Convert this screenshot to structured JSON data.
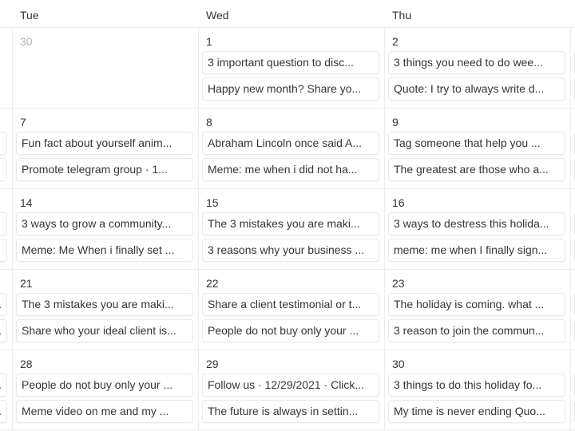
{
  "header": {
    "days": [
      "Tue",
      "Wed",
      "Thu"
    ]
  },
  "weeks": [
    {
      "days": [
        {
          "date": "30",
          "muted": true,
          "cards": []
        },
        {
          "date": "1",
          "cards": [
            "3 important question to disc...",
            "Happy new month? Share yo..."
          ]
        },
        {
          "date": "2",
          "cards": [
            "3 things you need to do wee...",
            "Quote: I try to always write d..."
          ]
        }
      ]
    },
    {
      "days": [
        {
          "date": "7",
          "cards": [
            "Fun fact about yourself anim...",
            "Promote telegram group  · 1..."
          ]
        },
        {
          "date": "8",
          "cards": [
            "Abraham Lincoln once said A...",
            "Meme: me when i did not ha..."
          ]
        },
        {
          "date": "9",
          "cards": [
            "Tag someone that help you ...",
            "The greatest are those who a..."
          ]
        }
      ]
    },
    {
      "days": [
        {
          "date": "14",
          "cards": [
            "3 ways to grow a community...",
            "Meme: Me When i finally set ..."
          ]
        },
        {
          "date": "15",
          "cards": [
            "The 3 mistakes you are maki...",
            "3 reasons why your business ..."
          ]
        },
        {
          "date": "16",
          "cards": [
            "3 ways to destress this holida...",
            "meme: me when I finally sign..."
          ]
        }
      ]
    },
    {
      "days": [
        {
          "date": "21",
          "cards": [
            "The 3 mistakes you are maki...",
            "Share who your ideal client is..."
          ]
        },
        {
          "date": "22",
          "cards": [
            "Share a client testimonial or t...",
            "People do not buy only your ..."
          ]
        },
        {
          "date": "23",
          "cards": [
            "The holiday is coming. what ...",
            "3 reason to join the commun..."
          ]
        }
      ]
    },
    {
      "days": [
        {
          "date": "28",
          "cards": [
            "People do not buy only your ...",
            "Meme video on me and my ..."
          ]
        },
        {
          "date": "29",
          "cards": [
            "Follow us · 12/29/2021 · Click...",
            "The future is always in settin..."
          ]
        },
        {
          "date": "30",
          "cards": [
            "3 things to do this holiday fo...",
            "My time is never ending Quo..."
          ]
        }
      ]
    }
  ],
  "edge_cards": {
    "left": [
      [],
      [
        "",
        ""
      ],
      [
        "",
        ""
      ],
      [
        ".",
        "."
      ],
      [
        ".",
        "."
      ]
    ],
    "right": [
      [
        "",
        ""
      ],
      [
        "",
        ""
      ],
      [
        "",
        ""
      ],
      [
        "",
        ""
      ],
      [
        "",
        ""
      ]
    ]
  }
}
